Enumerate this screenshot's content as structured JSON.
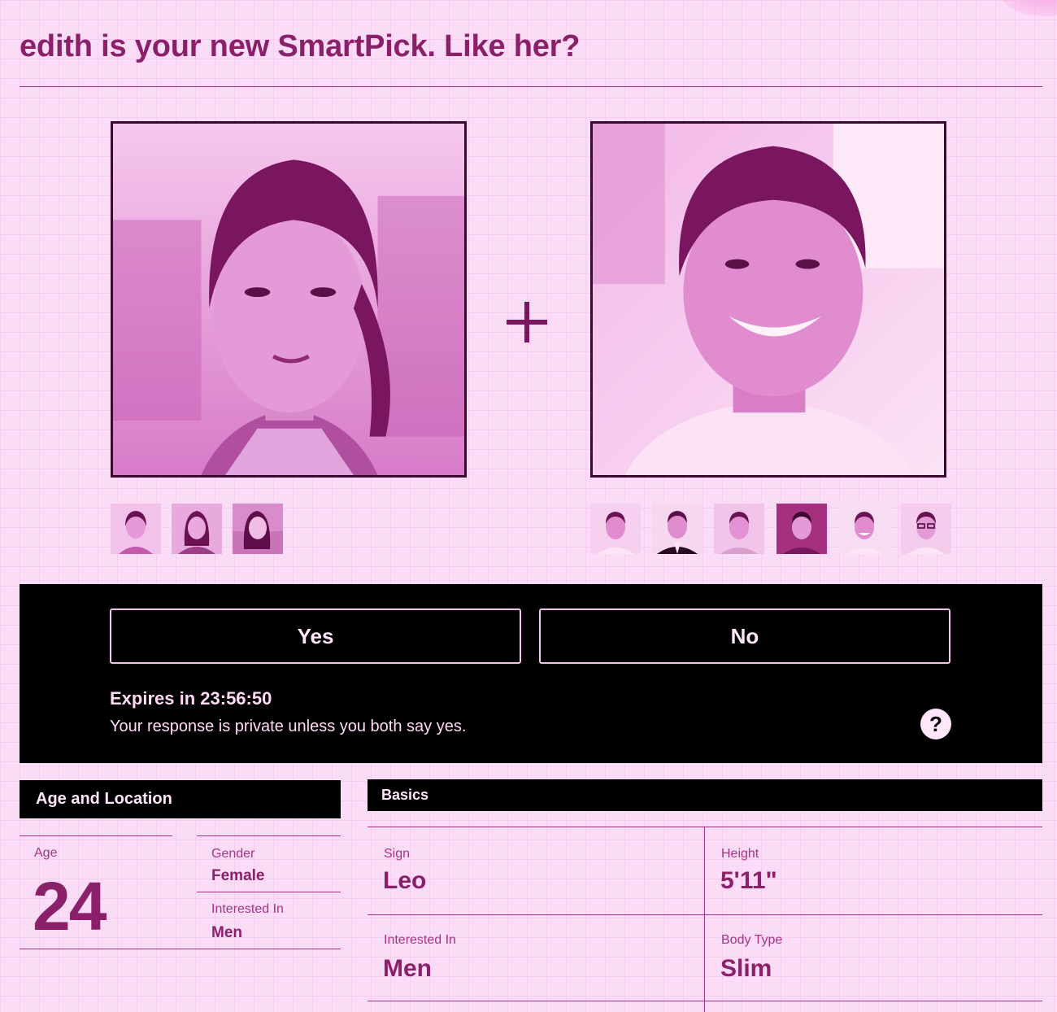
{
  "headline": "edith is your new SmartPick. Like her?",
  "plus_symbol": "+",
  "actions": {
    "yes_label": "Yes",
    "no_label": "No",
    "expires_text": "Expires in 23:56:50",
    "privacy_text": "Your response is private unless you both say yes.",
    "help_glyph": "?"
  },
  "age_location": {
    "header": "Age and Location",
    "age_label": "Age",
    "age_value": "24",
    "gender_label": "Gender",
    "gender_value": "Female",
    "interested_label": "Interested In",
    "interested_value": "Men"
  },
  "basics": {
    "header": "Basics",
    "sign_label": "Sign",
    "sign_value": "Leo",
    "height_label": "Height",
    "height_value": "5'11\"",
    "interested_label": "Interested In",
    "interested_value": "Men",
    "body_type_label": "Body Type",
    "body_type_value": "Slim"
  },
  "theme": {
    "background": "#fbdcf6",
    "text_magenta": "#8a1f6a",
    "panel_black": "#000000"
  }
}
